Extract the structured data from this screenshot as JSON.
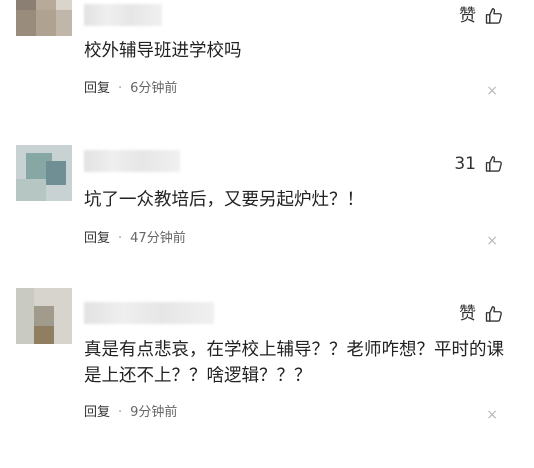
{
  "comments": [
    {
      "like_label": "赞",
      "text": "校外辅导班进学校吗",
      "reply_label": "回复",
      "separator": "·",
      "time": "6分钟前",
      "close_glyph": "×"
    },
    {
      "like_label": "31",
      "text": "坑了一众教培后，又要另起炉灶？！",
      "reply_label": "回复",
      "separator": "·",
      "time": "47分钟前",
      "close_glyph": "×"
    },
    {
      "like_label": "赞",
      "text": "真是有点悲哀，在学校上辅导？？老师咋想？平时的课是上还不上？？啥逻辑？？？",
      "reply_label": "回复",
      "separator": "·",
      "time": "9分钟前",
      "close_glyph": "×"
    }
  ],
  "icons": {
    "like": "thumbs-up-icon",
    "dismiss": "close-icon"
  }
}
